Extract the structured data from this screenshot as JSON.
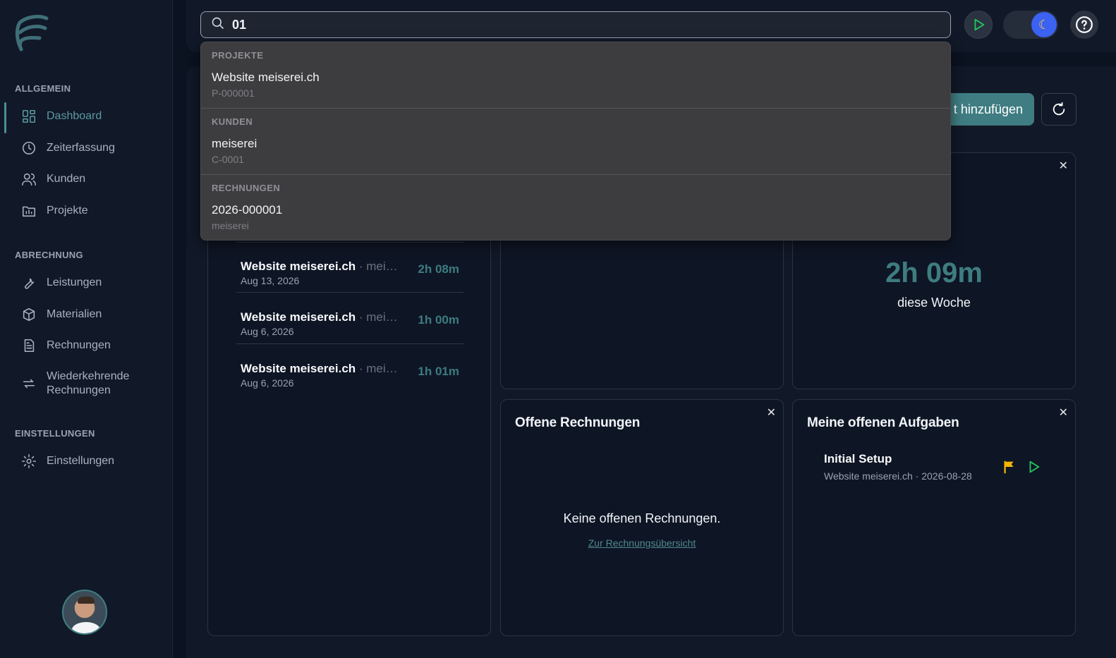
{
  "search": {
    "value": "01"
  },
  "sidebar": {
    "sections": [
      "Allgemein",
      "Abrechnung",
      "Einstellungen"
    ],
    "items": [
      {
        "label": "Dashboard"
      },
      {
        "label": "Zeiterfassung"
      },
      {
        "label": "Kunden"
      },
      {
        "label": "Projekte"
      },
      {
        "label": "Leistungen"
      },
      {
        "label": "Materialien"
      },
      {
        "label": "Rechnungen"
      },
      {
        "label": "Wiederkehrende Rechnungen"
      },
      {
        "label": "Einstellungen"
      }
    ]
  },
  "header": {
    "add_label": "t hinzufügen"
  },
  "recent_entries": [
    {
      "project": "Website meiserei.ch",
      "client": "· mei…",
      "date": "Aug 13, 2026",
      "duration": "2h 08m"
    },
    {
      "project": "Website meiserei.ch",
      "client": "· mei…",
      "date": "Aug 6, 2026",
      "duration": "1h 00m"
    },
    {
      "project": "Website meiserei.ch",
      "client": "· mei…",
      "date": "Aug 6, 2026",
      "duration": "1h 01m"
    }
  ],
  "week_card": {
    "duration": "2h 09m",
    "label": "diese Woche"
  },
  "invoices_card": {
    "title": "Offene Rechnungen",
    "empty": "Keine offenen Rechnungen.",
    "link": "Zur Rechnungsübersicht"
  },
  "tasks_card": {
    "title": "Meine offenen Aufgaben",
    "task_title": "Initial Setup",
    "task_sub": "Website meiserei.ch · 2026-08-28"
  },
  "dropdown": {
    "groups": [
      {
        "label": "PROJEKTE",
        "item": "Website meiserei.ch",
        "sub": "P-000001"
      },
      {
        "label": "KUNDEN",
        "item": "meiserei",
        "sub": "C-0001"
      },
      {
        "label": "RECHNUNGEN",
        "item": "2026-000001",
        "sub": "meiserei"
      }
    ]
  },
  "colors": {
    "accent": "#3f7d82",
    "play": "#22c55e",
    "flag": "#f5b400",
    "toggle_knob": "#3b62f0"
  }
}
